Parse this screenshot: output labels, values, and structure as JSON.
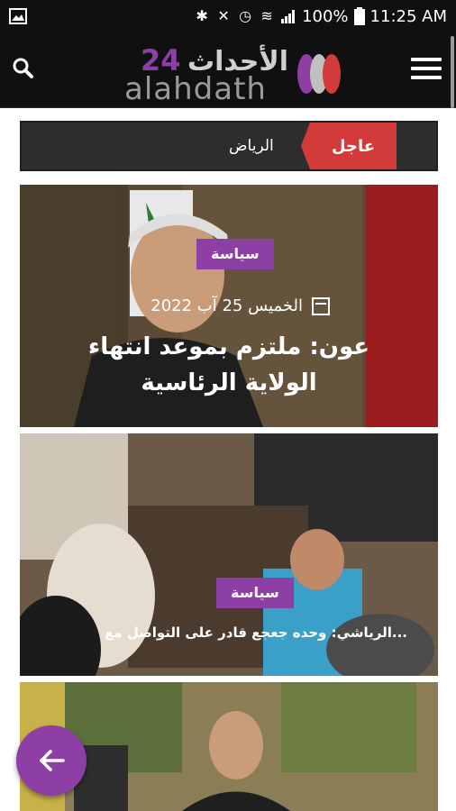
{
  "status_bar": {
    "battery": "100%",
    "time": "11:25 AM"
  },
  "header": {
    "logo_arabic": "الأحداث",
    "logo_number": "24",
    "logo_latin": "alahdath"
  },
  "ticker": {
    "badge": "عاجل",
    "text": "الرياض"
  },
  "articles": [
    {
      "category": "سياسة",
      "date": "الخميس 25 آب 2022",
      "title": "عون: ملتزم بموعد انتهاء الولاية الرئاسية"
    },
    {
      "category": "سياسة",
      "title": "الرياشي: وحده جعجع قادر على التواصل مع..."
    },
    {}
  ],
  "colors": {
    "accent": "#8e3fa6",
    "breaking": "#d33b3b",
    "header_bg": "#101010"
  },
  "icons": {
    "search": "search-icon",
    "menu": "hamburger-menu-icon",
    "back": "arrow-left-icon",
    "calendar": "calendar-icon"
  }
}
